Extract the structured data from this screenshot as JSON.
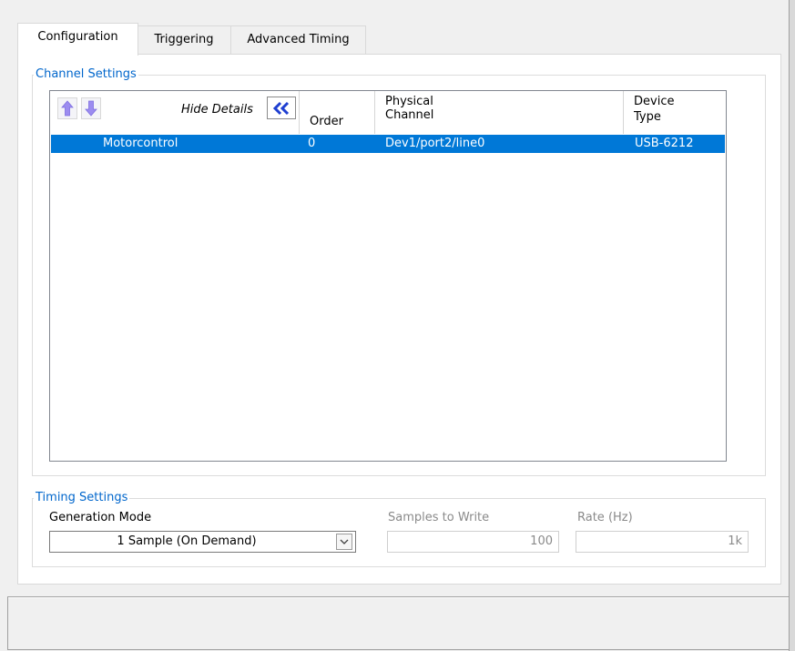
{
  "tabs": [
    {
      "label": "Configuration",
      "active": true
    },
    {
      "label": "Triggering",
      "active": false
    },
    {
      "label": "Advanced Timing",
      "active": false
    }
  ],
  "channel_settings": {
    "legend": "Channel Settings",
    "hide_details_label": "Hide Details",
    "columns": [
      "Order",
      "Physical",
      "Channel",
      "Device",
      "Type"
    ],
    "rows": [
      {
        "name": "Motorcontrol",
        "order": "0",
        "physical_channel": "Dev1/port2/line0",
        "device_type": "USB-6212",
        "selected": true
      }
    ]
  },
  "timing_settings": {
    "legend": "Timing Settings",
    "generation_mode": {
      "label": "Generation Mode",
      "value": "1 Sample (On Demand)"
    },
    "samples_to_write": {
      "label": "Samples to Write",
      "value": "100",
      "enabled": false
    },
    "rate": {
      "label": "Rate (Hz)",
      "value": "1k",
      "enabled": false
    }
  },
  "colors": {
    "accent_blue": "#0078d7",
    "legend_blue": "#0066cc",
    "arrow_lavender": "#9c8cf0",
    "collapse_blue": "#1f3fd1"
  }
}
